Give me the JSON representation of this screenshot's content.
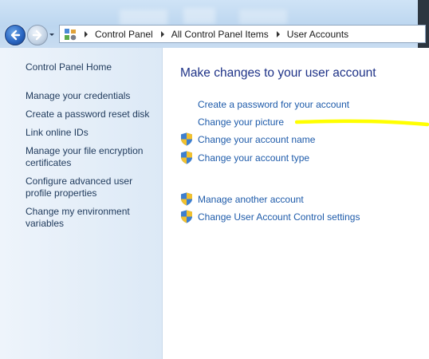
{
  "address_bar": {
    "breadcrumbs": [
      "Control Panel",
      "All Control Panel Items",
      "User Accounts"
    ]
  },
  "sidebar": {
    "home": "Control Panel Home",
    "items": [
      "Manage your credentials",
      "Create a password reset disk",
      "Link online IDs",
      "Manage your file encryption certificates",
      "Configure advanced user profile properties",
      "Change my environment variables"
    ]
  },
  "main": {
    "title": "Make changes to your user account",
    "tasks": [
      {
        "label": "Create a password for your account",
        "icon": "none"
      },
      {
        "label": "Change your picture",
        "icon": "none"
      },
      {
        "label": "Change your account name",
        "icon": "uac-shield-icon"
      },
      {
        "label": "Change your account type",
        "icon": "uac-shield-icon"
      }
    ],
    "other_tasks": [
      {
        "label": "Manage another account",
        "icon": "uac-shield-icon"
      },
      {
        "label": "Change User Account Control settings",
        "icon": "uac-shield-icon"
      }
    ]
  },
  "annotation": {
    "color": "#ffff00"
  },
  "colors": {
    "link": "#1e5baa",
    "title": "#1e3287",
    "sidebar_link": "#1e395b"
  }
}
